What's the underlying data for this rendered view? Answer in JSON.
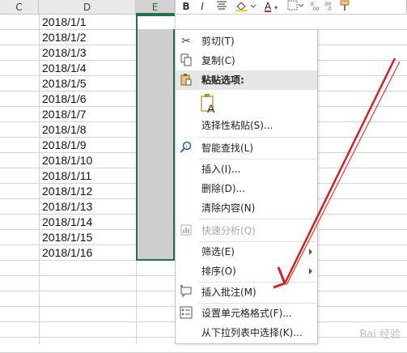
{
  "columns": {
    "c": "C",
    "d": "D",
    "e": "E"
  },
  "dates": [
    "2018/1/1",
    "2018/1/2",
    "2018/1/3",
    "2018/1/4",
    "2018/1/5",
    "2018/1/6",
    "2018/1/7",
    "2018/1/8",
    "2018/1/9",
    "2018/1/10",
    "2018/1/11",
    "2018/1/12",
    "2018/1/13",
    "2018/1/14",
    "2018/1/15",
    "2018/1/16"
  ],
  "mini_toolbar": {
    "bold": "B",
    "italic": "I",
    "font_color": "A"
  },
  "menu": {
    "cut": "剪切(T)",
    "copy": "复制(C)",
    "paste_options": "粘贴选项:",
    "paste_special": "选择性粘贴(S)...",
    "smart_lookup": "智能查找(L)",
    "insert": "插入(I)...",
    "delete": "删除(D)...",
    "clear_contents": "清除内容(N)",
    "quick_analysis": "快速分析(Q)",
    "filter": "筛选(E)",
    "sort": "排序(O)",
    "insert_comment": "插入批注(M)",
    "format_cells": "设置单元格格式(F)...",
    "pick_from_list": "从下拉列表中选择(K)..."
  },
  "watermark": "Bai 经验",
  "colors": {
    "selection_border": "#217346",
    "annotation_arrow": "#d81e1e",
    "menu_header_bg": "#e6e6e6"
  }
}
